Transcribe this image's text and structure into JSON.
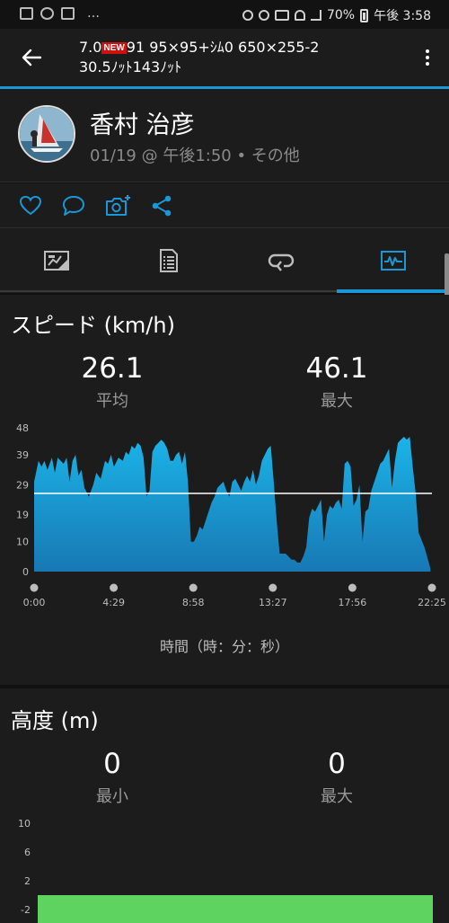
{
  "status": {
    "battery": "70%",
    "time": "午後 3:58"
  },
  "appbar": {
    "title_prefix": "7.0",
    "new_badge": "NEW",
    "title_rest": "91 95×95+ｼﾑ0 650×255-2",
    "title_line2": "30.5ﾉｯﾄ143ﾉｯﾄ"
  },
  "user": {
    "name": "香村 治彦",
    "subtitle": "01/19 @ 午後1:50 • その他"
  },
  "actions": [
    {
      "name": "like",
      "icon": "heart-icon"
    },
    {
      "name": "comment",
      "icon": "speech-bubble-icon"
    },
    {
      "name": "add-photo",
      "icon": "camera-plus-icon"
    },
    {
      "name": "share",
      "icon": "share-icon"
    }
  ],
  "tabs": [
    {
      "name": "overview",
      "icon": "map-card-icon",
      "active": false
    },
    {
      "name": "details",
      "icon": "document-list-icon",
      "active": false
    },
    {
      "name": "laps",
      "icon": "loop-arrow-icon",
      "active": false
    },
    {
      "name": "charts",
      "icon": "pulse-chart-icon",
      "active": true
    }
  ],
  "colors": {
    "accent": "#1a97d4",
    "chart_fill_top": "#1bb4e8",
    "chart_fill_bottom": "#1878b4",
    "elevation_green": "#5fd35f",
    "background": "#111111",
    "card": "#1c1c1c"
  },
  "speed": {
    "title": "スピード (km/h)",
    "avg_value": "26.1",
    "avg_label": "平均",
    "max_value": "46.1",
    "max_label": "最大",
    "x_title": "時間（時：分：秒）"
  },
  "elevation": {
    "title": "高度 (m)",
    "min_value": "0",
    "min_label": "最小",
    "max_value": "0",
    "max_label": "最大"
  },
  "chart_data": [
    {
      "type": "area",
      "title": "スピード (km/h)",
      "xlabel": "時間（時：分：秒）",
      "ylabel": "",
      "x_ticks": [
        "0:00",
        "4:29",
        "8:58",
        "13:27",
        "17:56",
        "22:25"
      ],
      "y_ticks": [
        "0",
        "10",
        "19",
        "29",
        "39",
        "48"
      ],
      "xlim": [
        0,
        1345
      ],
      "ylim": [
        0,
        48
      ],
      "average_line": 26.1,
      "grid": false,
      "series": [
        {
          "x": [
            0,
            15,
            25,
            35,
            45,
            60,
            70,
            80,
            90,
            100,
            110,
            120,
            130,
            140,
            150,
            160,
            170,
            185,
            200,
            210,
            225,
            240,
            250,
            260,
            270,
            285,
            300,
            310,
            320,
            330,
            340,
            350,
            360,
            370,
            380,
            390,
            400,
            410,
            420,
            430,
            440,
            450,
            460,
            470,
            480,
            490,
            500,
            510,
            520,
            530,
            540,
            550,
            560,
            570,
            580,
            590,
            600,
            610,
            620,
            630,
            640,
            650,
            660,
            670,
            680,
            690,
            700,
            710,
            720,
            730,
            740,
            750,
            760,
            770,
            780,
            790,
            800,
            810,
            820,
            830,
            840,
            850,
            860,
            870,
            880,
            890,
            900,
            910,
            920,
            930,
            940,
            950,
            960,
            970,
            980,
            990,
            1000,
            1010,
            1020,
            1030,
            1040,
            1050,
            1060,
            1070,
            1080,
            1090,
            1100,
            1110,
            1120,
            1130,
            1140,
            1150,
            1160,
            1170,
            1180,
            1190,
            1200,
            1210,
            1220,
            1230,
            1240,
            1250,
            1260,
            1270,
            1280,
            1290,
            1300,
            1320,
            1340
          ],
          "y": [
            30,
            37,
            35,
            37,
            34,
            38,
            33,
            38,
            37,
            36,
            38,
            30,
            37,
            39,
            32,
            34,
            28,
            25,
            29,
            33,
            31,
            37,
            36,
            39,
            35,
            38,
            37,
            40,
            39,
            42,
            41,
            43,
            42,
            38,
            25,
            27,
            40,
            42,
            43,
            44,
            43,
            41,
            37,
            37,
            39,
            40,
            36,
            40,
            30,
            10,
            10,
            12,
            15,
            14,
            17,
            20,
            23,
            25,
            28,
            29,
            30,
            27,
            25,
            30,
            31,
            29,
            27,
            30,
            32,
            30,
            34,
            29,
            32,
            37,
            39,
            41,
            42,
            30,
            17,
            6,
            6,
            6,
            5,
            4,
            4,
            3,
            3,
            5,
            8,
            18,
            21,
            20,
            22,
            24,
            10,
            19,
            22,
            21,
            23,
            24,
            21,
            36,
            37,
            35,
            22,
            24,
            29,
            10,
            20,
            21,
            27,
            30,
            33,
            36,
            37,
            39,
            41,
            28,
            37,
            43,
            44,
            45,
            44,
            45,
            35,
            26,
            13,
            8,
            1
          ],
          "color": "#1bb4e8"
        }
      ]
    },
    {
      "type": "area",
      "title": "高度 (m)",
      "xlabel": "",
      "ylabel": "",
      "y_ticks": [
        "-2",
        "2",
        "6",
        "10"
      ],
      "ylim": [
        -2,
        10
      ],
      "series": [
        {
          "x": [
            0,
            1345
          ],
          "y": [
            0,
            0
          ],
          "color": "#5fd35f"
        }
      ]
    }
  ]
}
